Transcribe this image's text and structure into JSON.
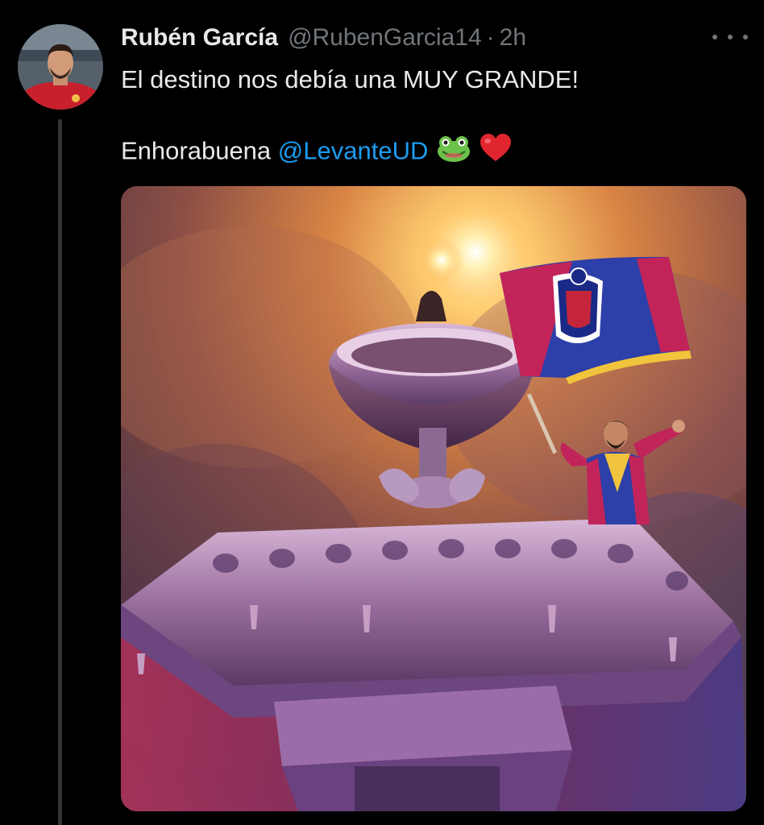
{
  "tweet": {
    "display_name": "Rubén García",
    "handle": "@RubenGarcia14",
    "separator": "·",
    "time": "2h",
    "text_line1": "El destino nos debía una MUY GRANDE!",
    "text_line2_prefix": "Enhorabuena ",
    "mention": "@LevanteUD",
    "emojis": [
      "frog-emoji",
      "red-heart-emoji"
    ],
    "more_icon": "more-horizontal-icon"
  },
  "colors": {
    "background": "#000000",
    "text": "#e7e9ea",
    "secondary": "#71767b",
    "link": "#1d9bf0",
    "thread_line": "#333639"
  }
}
